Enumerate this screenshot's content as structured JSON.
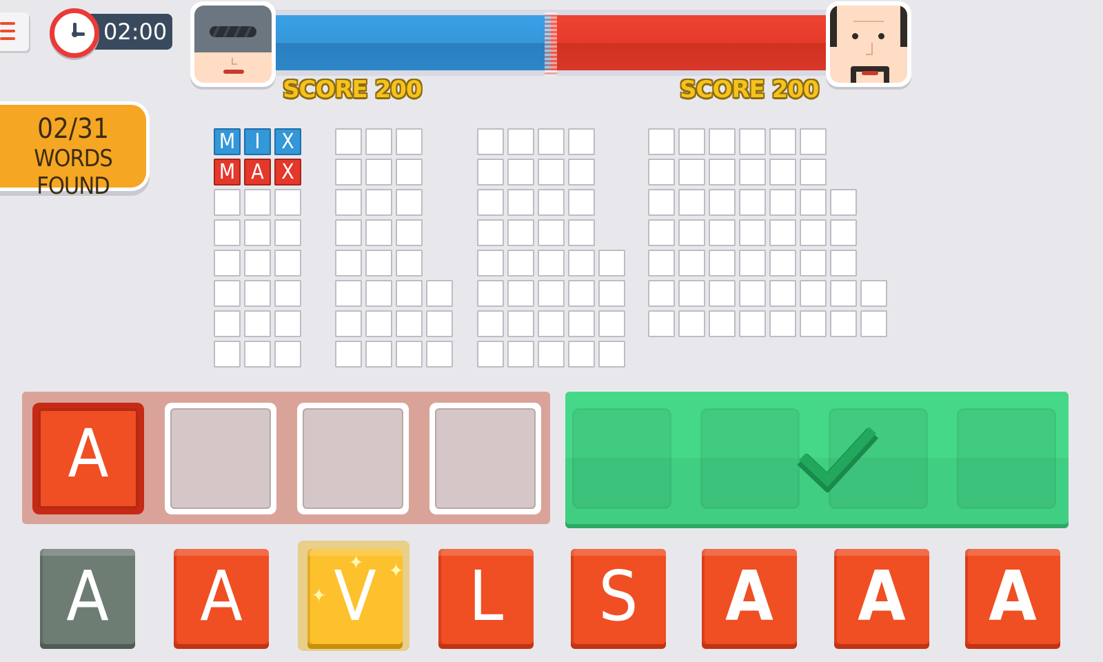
{
  "timer": {
    "value": "02:00"
  },
  "players": [
    {
      "name": "player-1",
      "score_label": "SCORE 200",
      "bar_color": "#3598da"
    },
    {
      "name": "player-2",
      "score_label": "SCORE 200",
      "bar_color": "#e63b2b"
    }
  ],
  "score_balance": 0.5,
  "progress": {
    "count": "02/31",
    "label": "WORDS FOUND"
  },
  "word_groups": [
    {
      "columns": 3,
      "rows": [
        3,
        3,
        3,
        3,
        3,
        3,
        3,
        3
      ],
      "found": [
        {
          "row": 0,
          "letters": [
            "M",
            "I",
            "X"
          ],
          "color": "blue"
        },
        {
          "row": 1,
          "letters": [
            "M",
            "A",
            "X"
          ],
          "color": "red"
        }
      ]
    },
    {
      "columns": 4,
      "rows": [
        3,
        3,
        3,
        3,
        3,
        4,
        4,
        4
      ],
      "found": []
    },
    {
      "columns": 5,
      "rows": [
        4,
        4,
        4,
        4,
        5,
        5,
        5,
        5
      ],
      "found": []
    },
    {
      "columns": 8,
      "rows": [
        6,
        6,
        7,
        7,
        7,
        8,
        8
      ],
      "found": []
    }
  ],
  "input_slots": [
    "A",
    "",
    "",
    ""
  ],
  "submit": {
    "icon": "checkmark-icon",
    "color": "#46d889"
  },
  "rack": [
    {
      "letter": "A",
      "state": "used"
    },
    {
      "letter": "A",
      "state": "normal"
    },
    {
      "letter": "V",
      "state": "bonus"
    },
    {
      "letter": "L",
      "state": "normal"
    },
    {
      "letter": "S",
      "state": "normal"
    },
    {
      "letter": "A",
      "state": "normal"
    },
    {
      "letter": "A",
      "state": "normal"
    },
    {
      "letter": "A",
      "state": "normal"
    }
  ],
  "colors": {
    "accent": "#f04e23",
    "bonus": "#fcc12d",
    "used": "#6e7d74",
    "background": "#e8e8ec"
  }
}
